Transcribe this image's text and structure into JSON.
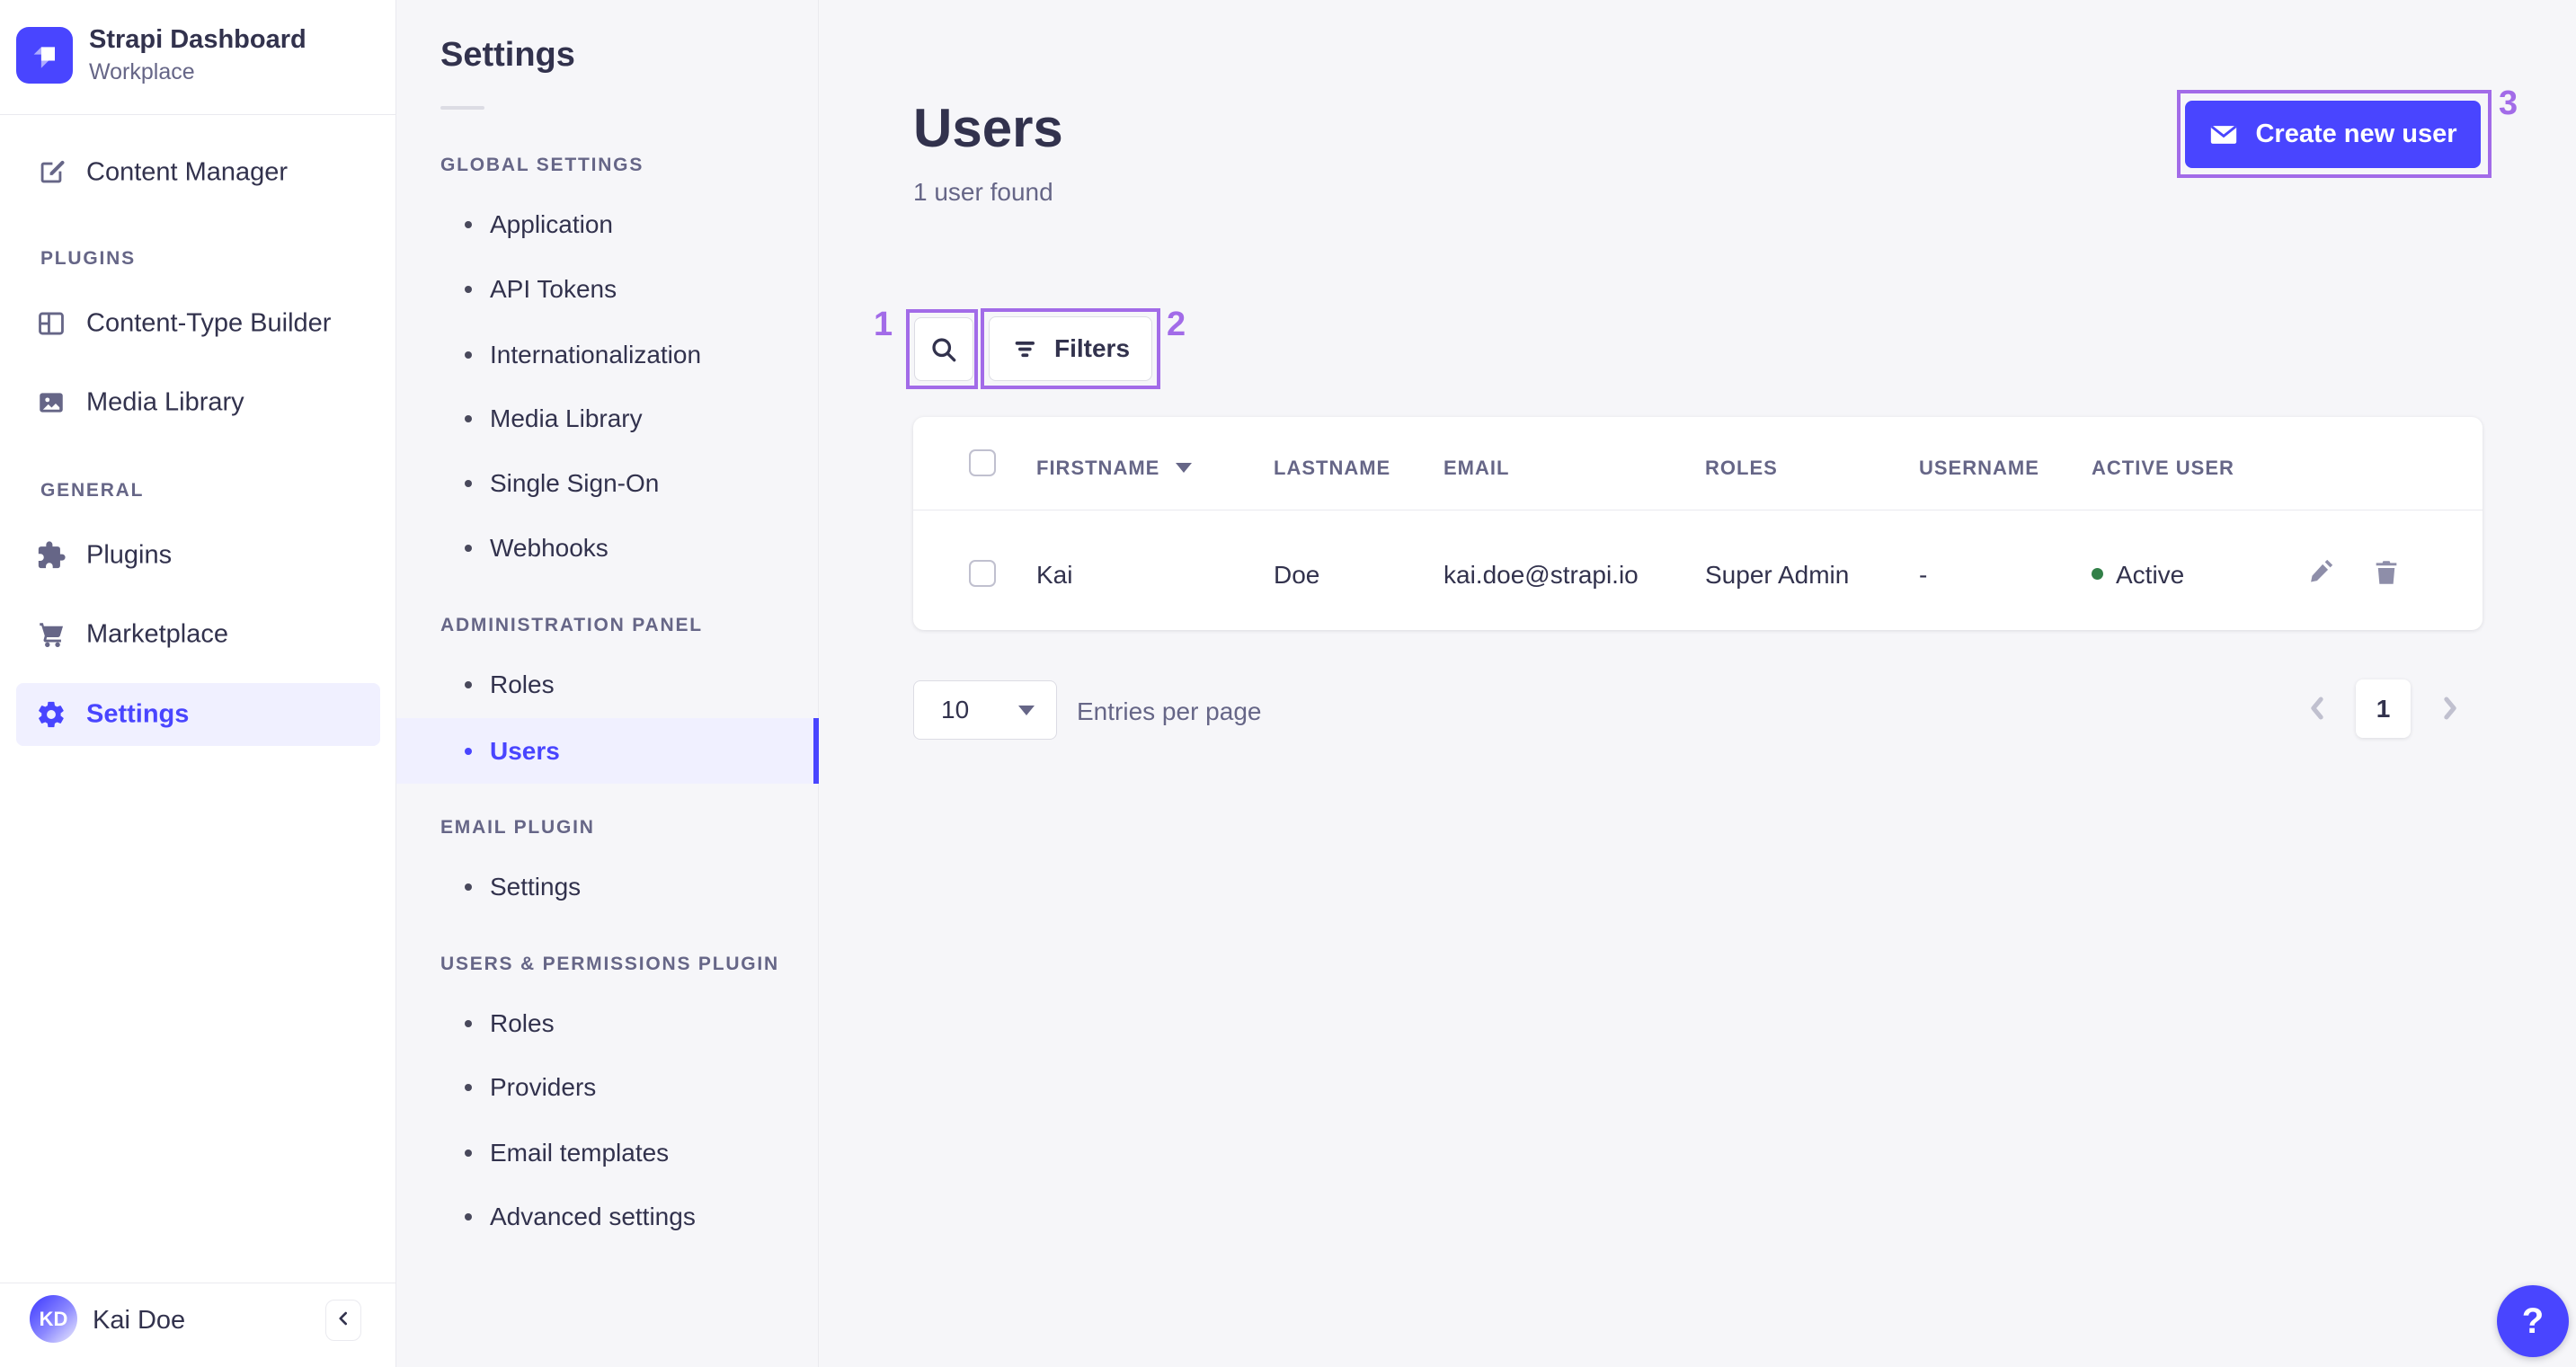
{
  "brand": {
    "name": "Strapi Dashboard",
    "workspace": "Workplace"
  },
  "colors": {
    "accent": "#4945ff",
    "annotation": "#a26be8",
    "success_green": "#328048"
  },
  "sidebar": {
    "content_manager": "Content Manager",
    "sections": [
      {
        "label": "PLUGINS",
        "items": [
          "Content-Type Builder",
          "Media Library"
        ]
      },
      {
        "label": "GENERAL",
        "items": [
          "Plugins",
          "Marketplace",
          "Settings"
        ]
      }
    ],
    "user": {
      "initials": "KD",
      "name": "Kai Doe"
    }
  },
  "subnav": {
    "title": "Settings",
    "active_item": "Users",
    "sections": [
      {
        "label": "GLOBAL SETTINGS",
        "items": [
          "Application",
          "API Tokens",
          "Internationalization",
          "Media Library",
          "Single Sign-On",
          "Webhooks"
        ]
      },
      {
        "label": "ADMINISTRATION PANEL",
        "items": [
          "Roles",
          "Users"
        ]
      },
      {
        "label": "EMAIL PLUGIN",
        "items": [
          "Settings"
        ]
      },
      {
        "label": "USERS & PERMISSIONS PLUGIN",
        "items": [
          "Roles",
          "Providers",
          "Email templates",
          "Advanced settings"
        ]
      }
    ]
  },
  "page": {
    "title": "Users",
    "subtitle": "1 user found",
    "create_button": "Create new user",
    "filters_button": "Filters"
  },
  "table": {
    "headers": {
      "firstname": "FIRSTNAME",
      "lastname": "LASTNAME",
      "email": "EMAIL",
      "roles": "ROLES",
      "username": "USERNAME",
      "active": "ACTIVE USER"
    },
    "rows": [
      {
        "firstname": "Kai",
        "lastname": "Doe",
        "email": "kai.doe@strapi.io",
        "roles": "Super Admin",
        "username": "-",
        "active": "Active"
      }
    ]
  },
  "pagination": {
    "page_size": "10",
    "entries_label": "Entries per page",
    "current_page": "1"
  },
  "annotations": {
    "one": "1",
    "two": "2",
    "three": "3"
  },
  "help_label": "?"
}
